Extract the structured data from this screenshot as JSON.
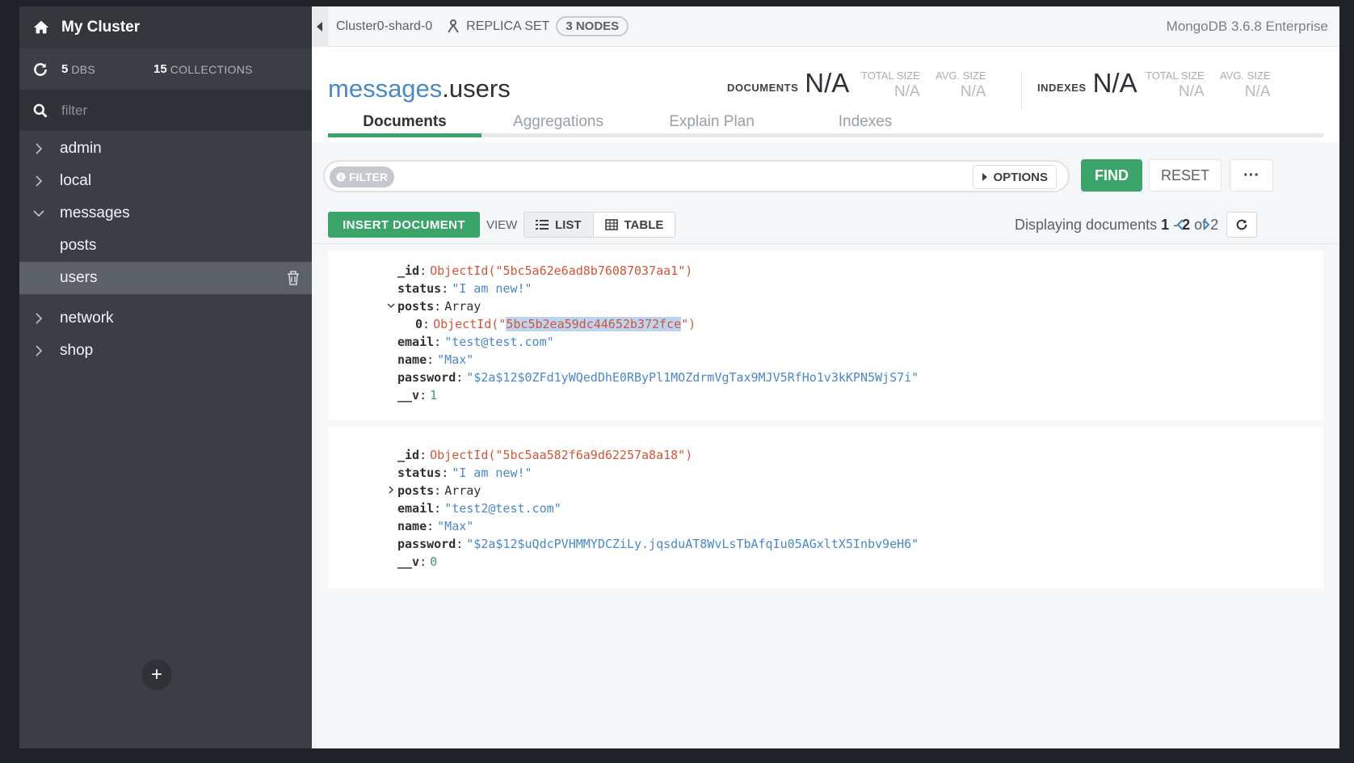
{
  "sidebar": {
    "title": "My Cluster",
    "dbs_count": "5",
    "dbs_label": "DBS",
    "collections_count": "15",
    "collections_label": "COLLECTIONS",
    "filter_placeholder": "filter",
    "databases": [
      {
        "name": "admin",
        "expanded": false
      },
      {
        "name": "local",
        "expanded": false
      },
      {
        "name": "messages",
        "expanded": true,
        "collections": [
          "posts",
          "users"
        ]
      },
      {
        "name": "network",
        "expanded": false
      },
      {
        "name": "shop",
        "expanded": false
      }
    ],
    "active_collection": "users",
    "add_label": "+"
  },
  "topbar": {
    "shard": "Cluster0-shard-0",
    "replica_label": "REPLICA SET",
    "nodes": "3 NODES",
    "version": "MongoDB 3.6.8 Enterprise"
  },
  "header": {
    "db": "messages",
    "collection": ".users",
    "documents_label": "DOCUMENTS",
    "documents_value": "N/A",
    "doc_total_size_label": "TOTAL SIZE",
    "doc_total_size_value": "N/A",
    "doc_avg_size_label": "AVG. SIZE",
    "doc_avg_size_value": "N/A",
    "indexes_label": "INDEXES",
    "indexes_value": "N/A",
    "idx_total_size_label": "TOTAL SIZE",
    "idx_total_size_value": "N/A",
    "idx_avg_size_label": "AVG. SIZE",
    "idx_avg_size_value": "N/A"
  },
  "tabs": [
    "Documents",
    "Aggregations",
    "Explain Plan",
    "Indexes"
  ],
  "query": {
    "filter_label": "FILTER",
    "options_label": "OPTIONS",
    "find_label": "FIND",
    "reset_label": "RESET",
    "more_label": "···"
  },
  "toolbar": {
    "insert_label": "INSERT DOCUMENT",
    "view_label": "VIEW",
    "list_label": "LIST",
    "table_label": "TABLE",
    "displaying_prefix": "Displaying documents",
    "range_start": "1",
    "range_sep": " - ",
    "range_end": "2",
    "of_label": "of",
    "total": "2"
  },
  "documents": [
    {
      "id_key": "_id",
      "id_fn": "ObjectId(\"",
      "id_val": "5bc5a62e6ad8b76087037aa1",
      "id_end": "\")",
      "status_key": "status",
      "status_val": "\"I am new!\"",
      "posts_key": "posts",
      "posts_type": "Array",
      "post0_key": "0",
      "post0_fn": "ObjectId(\"",
      "post0_val": "5bc5b2ea59dc44652b372fce",
      "post0_end": "\")",
      "email_key": "email",
      "email_val": "\"test@test.com\"",
      "name_key": "name",
      "name_val": "\"Max\"",
      "password_key": "password",
      "password_val": "\"$2a$12$0ZFd1yWQedDhE0RByPl1MOZdrmVgTax9MJV5RfHo1v3kKPN5WjS7i\"",
      "v_key": "__v",
      "v_val": "1"
    },
    {
      "id_key": "_id",
      "id_val_full": "ObjectId(\"5bc5aa582f6a9d62257a8a18\")",
      "status_key": "status",
      "status_val": "\"I am new!\"",
      "posts_key": "posts",
      "posts_type": "Array",
      "email_key": "email",
      "email_val": "\"test2@test.com\"",
      "name_key": "name",
      "name_val": "\"Max\"",
      "password_key": "password",
      "password_val": "\"$2a$12$uQdcPVHMMYDCZiLy.jqsduAT8WvLsTbAfqIu05AGxltX5Inbv9eH6\"",
      "v_key": "__v",
      "v_val": "0"
    }
  ]
}
